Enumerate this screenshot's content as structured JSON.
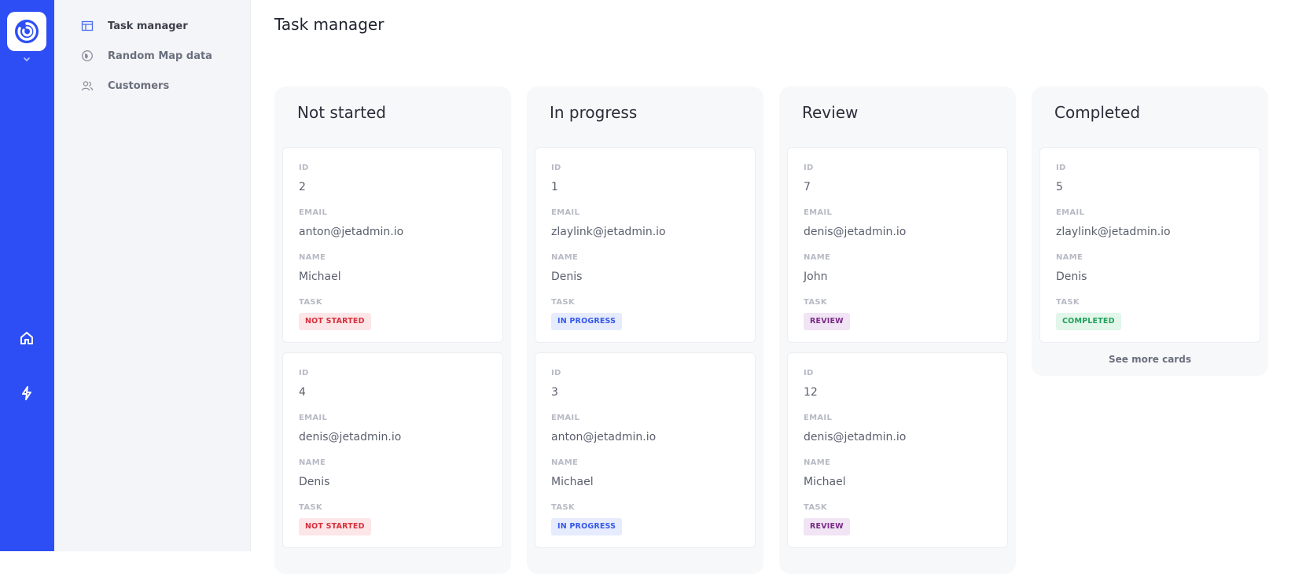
{
  "nav": {
    "items": [
      {
        "label": "Task manager",
        "icon": "table-icon",
        "active": true
      },
      {
        "label": "Random Map data",
        "icon": "globe-icon",
        "active": false
      },
      {
        "label": "Customers",
        "icon": "users-icon",
        "active": false
      }
    ]
  },
  "rail": {
    "icons": [
      "app-logo-icon",
      "chevron-down-icon",
      "home-icon",
      "lightning-icon"
    ],
    "accent": "#2d4ef5"
  },
  "page": {
    "title": "Task manager"
  },
  "field_labels": {
    "id": "ID",
    "email": "EMAIL",
    "name": "NAME",
    "task": "TASK"
  },
  "columns": [
    {
      "title": "Not started",
      "badge_bg": "#fde6e8",
      "badge_fg": "#d8303c",
      "cards": [
        {
          "id": "2",
          "email": "anton@jetadmin.io",
          "name": "Michael",
          "task": "NOT STARTED"
        },
        {
          "id": "4",
          "email": "denis@jetadmin.io",
          "name": "Denis",
          "task": "NOT STARTED"
        }
      ]
    },
    {
      "title": "In progress",
      "badge_bg": "#e6ecfd",
      "badge_fg": "#3658e8",
      "cards": [
        {
          "id": "1",
          "email": "zlaylink@jetadmin.io",
          "name": "Denis",
          "task": "IN PROGRESS"
        },
        {
          "id": "3",
          "email": "anton@jetadmin.io",
          "name": "Michael",
          "task": "IN PROGRESS"
        }
      ]
    },
    {
      "title": "Review",
      "badge_bg": "#f1e4f5",
      "badge_fg": "#7a2b86",
      "cards": [
        {
          "id": "7",
          "email": "denis@jetadmin.io",
          "name": "John",
          "task": "REVIEW"
        },
        {
          "id": "12",
          "email": "denis@jetadmin.io",
          "name": "Michael",
          "task": "REVIEW"
        }
      ]
    },
    {
      "title": "Completed",
      "badge_bg": "#e2f6ea",
      "badge_fg": "#22a05a",
      "see_more": "See more cards",
      "cards": [
        {
          "id": "5",
          "email": "zlaylink@jetadmin.io",
          "name": "Denis",
          "task": "COMPLETED"
        }
      ]
    }
  ]
}
